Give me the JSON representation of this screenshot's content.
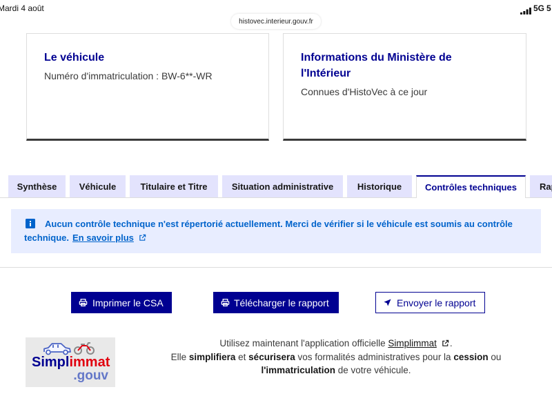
{
  "status_bar": {
    "date": "Mardi 4 août",
    "network": "5G",
    "battery": "5"
  },
  "browser": {
    "url": "histovec.interieur.gouv.fr"
  },
  "cards": [
    {
      "title": "Le véhicule",
      "text": "Numéro d'immatriculation : BW-6**-WR"
    },
    {
      "title": "Informations du Ministère de l'Intérieur",
      "text": "Connues d'HistoVec à ce jour"
    }
  ],
  "tabs": [
    {
      "label": "Synthèse",
      "active": false
    },
    {
      "label": "Véhicule",
      "active": false
    },
    {
      "label": "Titulaire et Titre",
      "active": false
    },
    {
      "label": "Situation administrative",
      "active": false
    },
    {
      "label": "Historique",
      "active": false
    },
    {
      "label": "Contrôles techniques",
      "active": true
    },
    {
      "label": "Rap",
      "active": false
    }
  ],
  "alert": {
    "icon": "info-icon",
    "message": "Aucun contrôle technique n'est répertorié actuellement. Merci de vérifier si le véhicule est soumis au contrôle technique.",
    "link_label": "En savoir plus",
    "link_icon": "external-link-icon"
  },
  "actions": [
    {
      "label": "Imprimer le CSA",
      "icon": "printer-icon"
    },
    {
      "label": "Télécharger le rapport",
      "icon": "printer-icon"
    },
    {
      "label": "Envoyer le rapport",
      "icon": "send-icon"
    }
  ],
  "promo": {
    "logo": {
      "part1": "Simpl",
      "part2": "immat",
      "suffix": ".gouv",
      "icons": [
        "car-icon",
        "motorcycle-icon"
      ]
    },
    "line1": {
      "text": "Utilisez maintenant l'application officielle ",
      "link": "Simplimmat",
      "end": "."
    },
    "line2": [
      "Elle ",
      "simplifiera",
      " et ",
      "sécurisera",
      " vos formalités administratives pour la ",
      "cession",
      " ou"
    ],
    "line3": [
      "l'immatriculation",
      " de votre véhicule."
    ]
  },
  "colors": {
    "primary": "#000091",
    "info": "#0063cb",
    "tab_bg": "#e3e3fd",
    "alert_bg": "#e8edff",
    "logo_red": "#e1000f",
    "logo_blue": "#6478c8"
  }
}
